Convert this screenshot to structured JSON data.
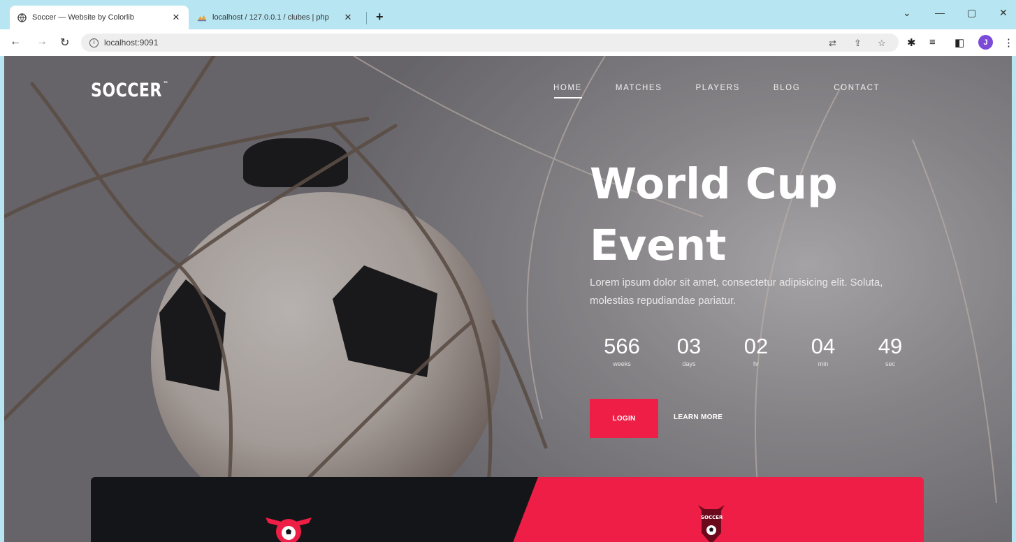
{
  "browser": {
    "tabs": [
      {
        "title": "Soccer — Website by Colorlib",
        "close": "✕",
        "icon": "globe-icon"
      },
      {
        "title": "localhost / 127.0.0.1 / clubes | php",
        "close": "✕",
        "icon": "phpmyadmin-icon"
      }
    ],
    "new_tab": "+",
    "url": "localhost:9091",
    "profile_initial": "J"
  },
  "site": {
    "logo": "SOCCER",
    "logo_mark": "™",
    "nav": [
      {
        "label": "HOME",
        "active": true
      },
      {
        "label": "MATCHES",
        "active": false
      },
      {
        "label": "PLAYERS",
        "active": false
      },
      {
        "label": "BLOG",
        "active": false
      },
      {
        "label": "CONTACT",
        "active": false
      }
    ]
  },
  "hero": {
    "title_line1": "World Cup",
    "title_line2": "Event",
    "text": "Lorem ipsum dolor sit amet, consectetur adipisicing elit. Soluta, molestias repudiandae pariatur.",
    "countdown": [
      {
        "value": "566",
        "label": "weeks"
      },
      {
        "value": "03",
        "label": "days"
      },
      {
        "value": "02",
        "label": "hr"
      },
      {
        "value": "04",
        "label": "min"
      },
      {
        "value": "49",
        "label": "sec"
      }
    ],
    "login_label": "LOGIN",
    "more_label": "LEARN MORE"
  },
  "panel": {
    "team2_badge": "SOCCER"
  },
  "colors": {
    "accent": "#ee1e46",
    "dark_panel": "#141518",
    "browser_frame": "#b7e5f1"
  }
}
